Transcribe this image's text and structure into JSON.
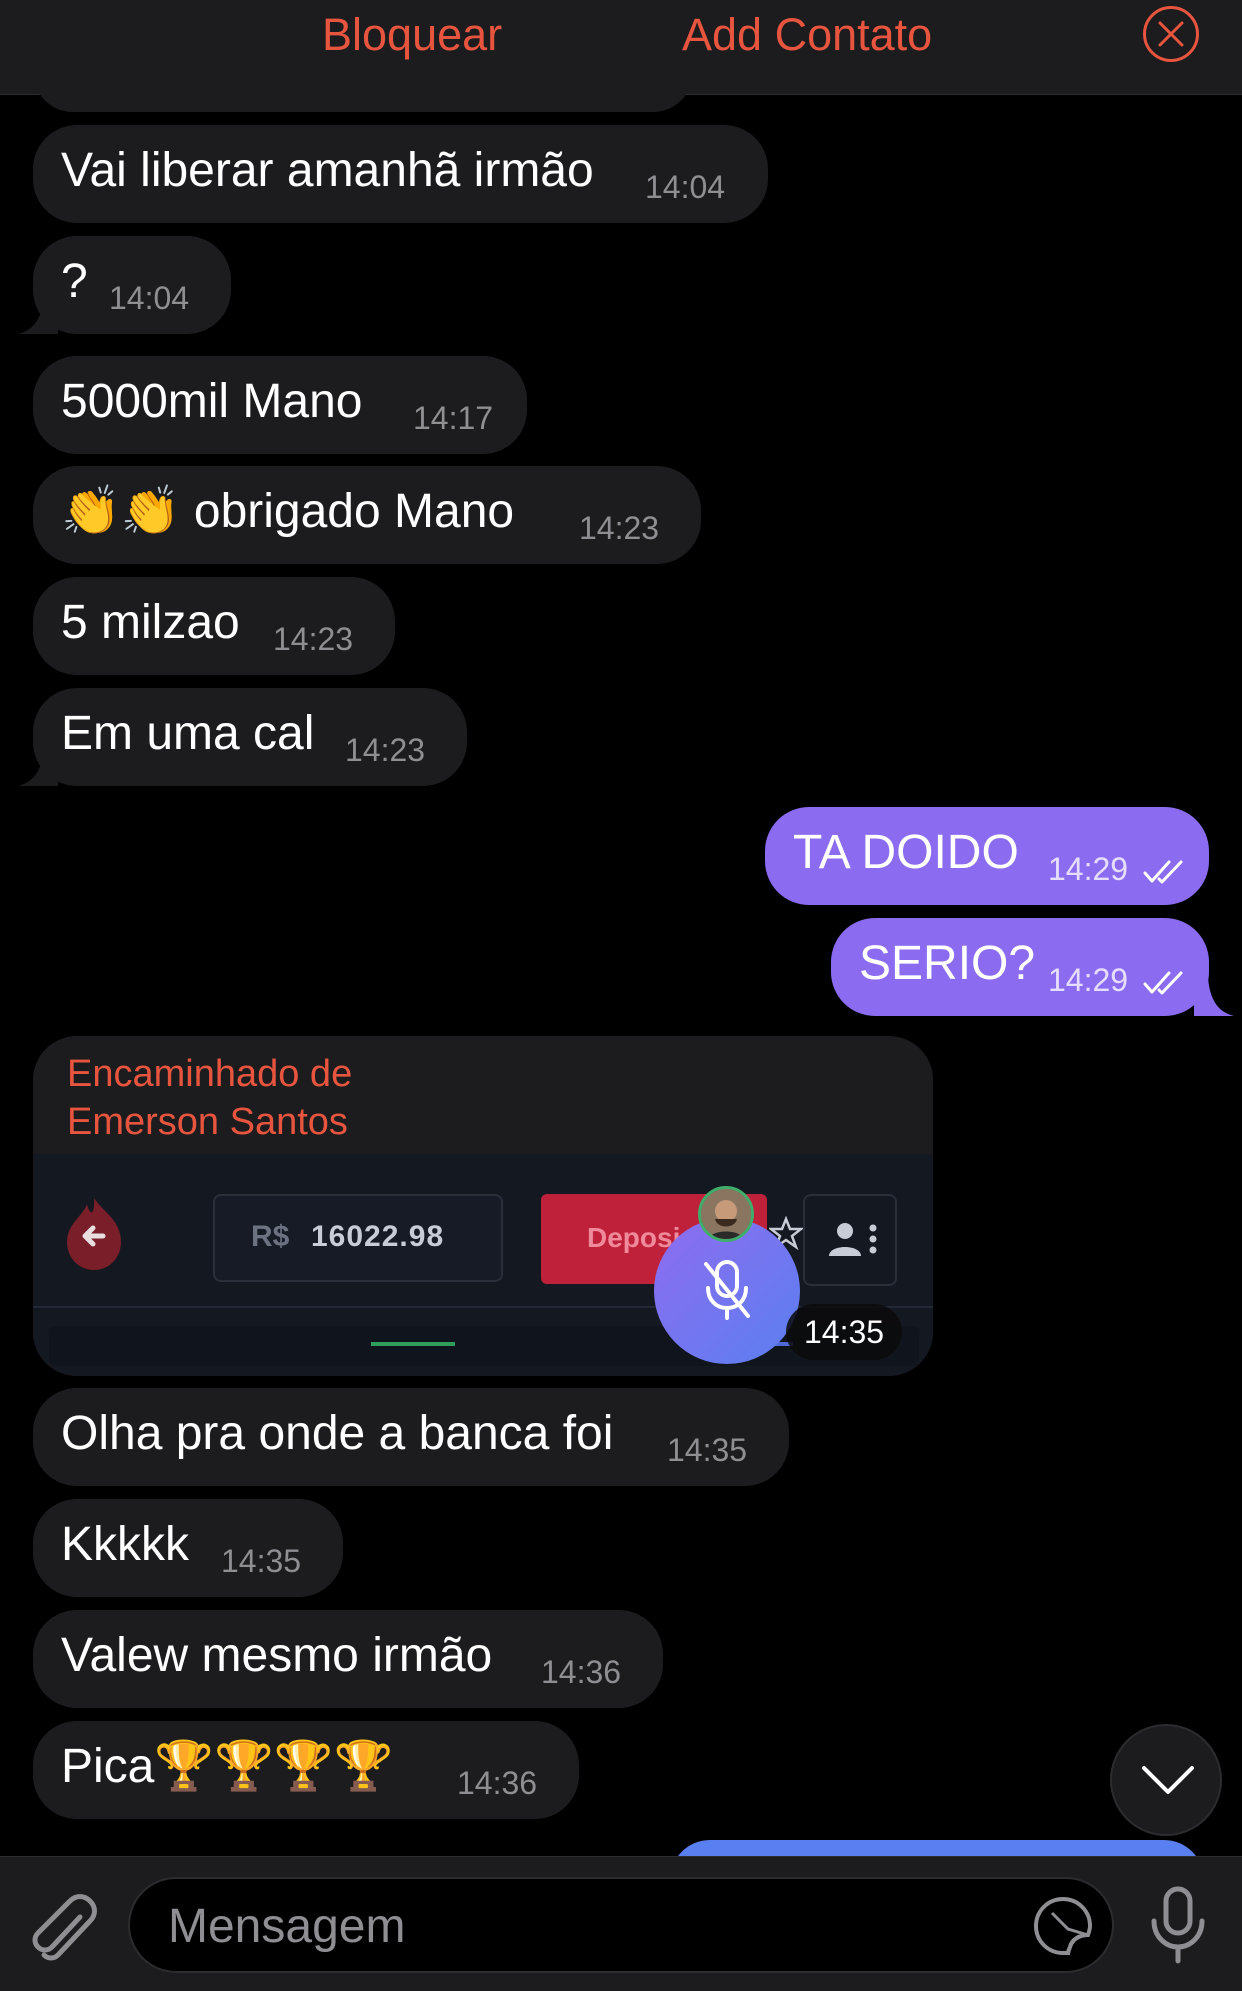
{
  "header": {
    "block_label": "Bloquear",
    "add_contact_label": "Add Contato",
    "close_icon": "close-circle-icon"
  },
  "messages": [
    {
      "text": "Vai liberar amanhã irmão",
      "time": "14:04",
      "direction": "in"
    },
    {
      "text": "?",
      "time": "14:04",
      "direction": "in"
    },
    {
      "text": "5000mil Mano",
      "time": "14:17",
      "direction": "in"
    },
    {
      "text": "👏👏 obrigado Mano",
      "time": "14:23",
      "direction": "in"
    },
    {
      "text": "5 milzao",
      "time": "14:23",
      "direction": "in"
    },
    {
      "text": "Em uma cal",
      "time": "14:23",
      "direction": "in"
    },
    {
      "text": "TA DOIDO",
      "time": "14:29",
      "direction": "out"
    },
    {
      "text": "SERIO?",
      "time": "14:29",
      "direction": "out"
    },
    {
      "text": "Olha pra onde a banca foi",
      "time": "14:35",
      "direction": "in"
    },
    {
      "text": "Kkkkk",
      "time": "14:35",
      "direction": "in"
    },
    {
      "text": "Valew mesmo irmão",
      "time": "14:36",
      "direction": "in"
    },
    {
      "text": "Pica🏆🏆🏆🏆",
      "time": "14:36",
      "direction": "in"
    }
  ],
  "forwarded": {
    "label": "Encaminhado de",
    "sender": "Emerson Santos",
    "time": "14:35",
    "screenshot": {
      "currency": "R$",
      "balance": "16022.98",
      "deposit_label": "Deposi"
    }
  },
  "composer": {
    "placeholder": "Mensagem",
    "value": ""
  },
  "colors": {
    "accent": "#e8553f",
    "outgoing_bubble": "#8b6cf0",
    "incoming_bubble": "#1c1c1e"
  }
}
